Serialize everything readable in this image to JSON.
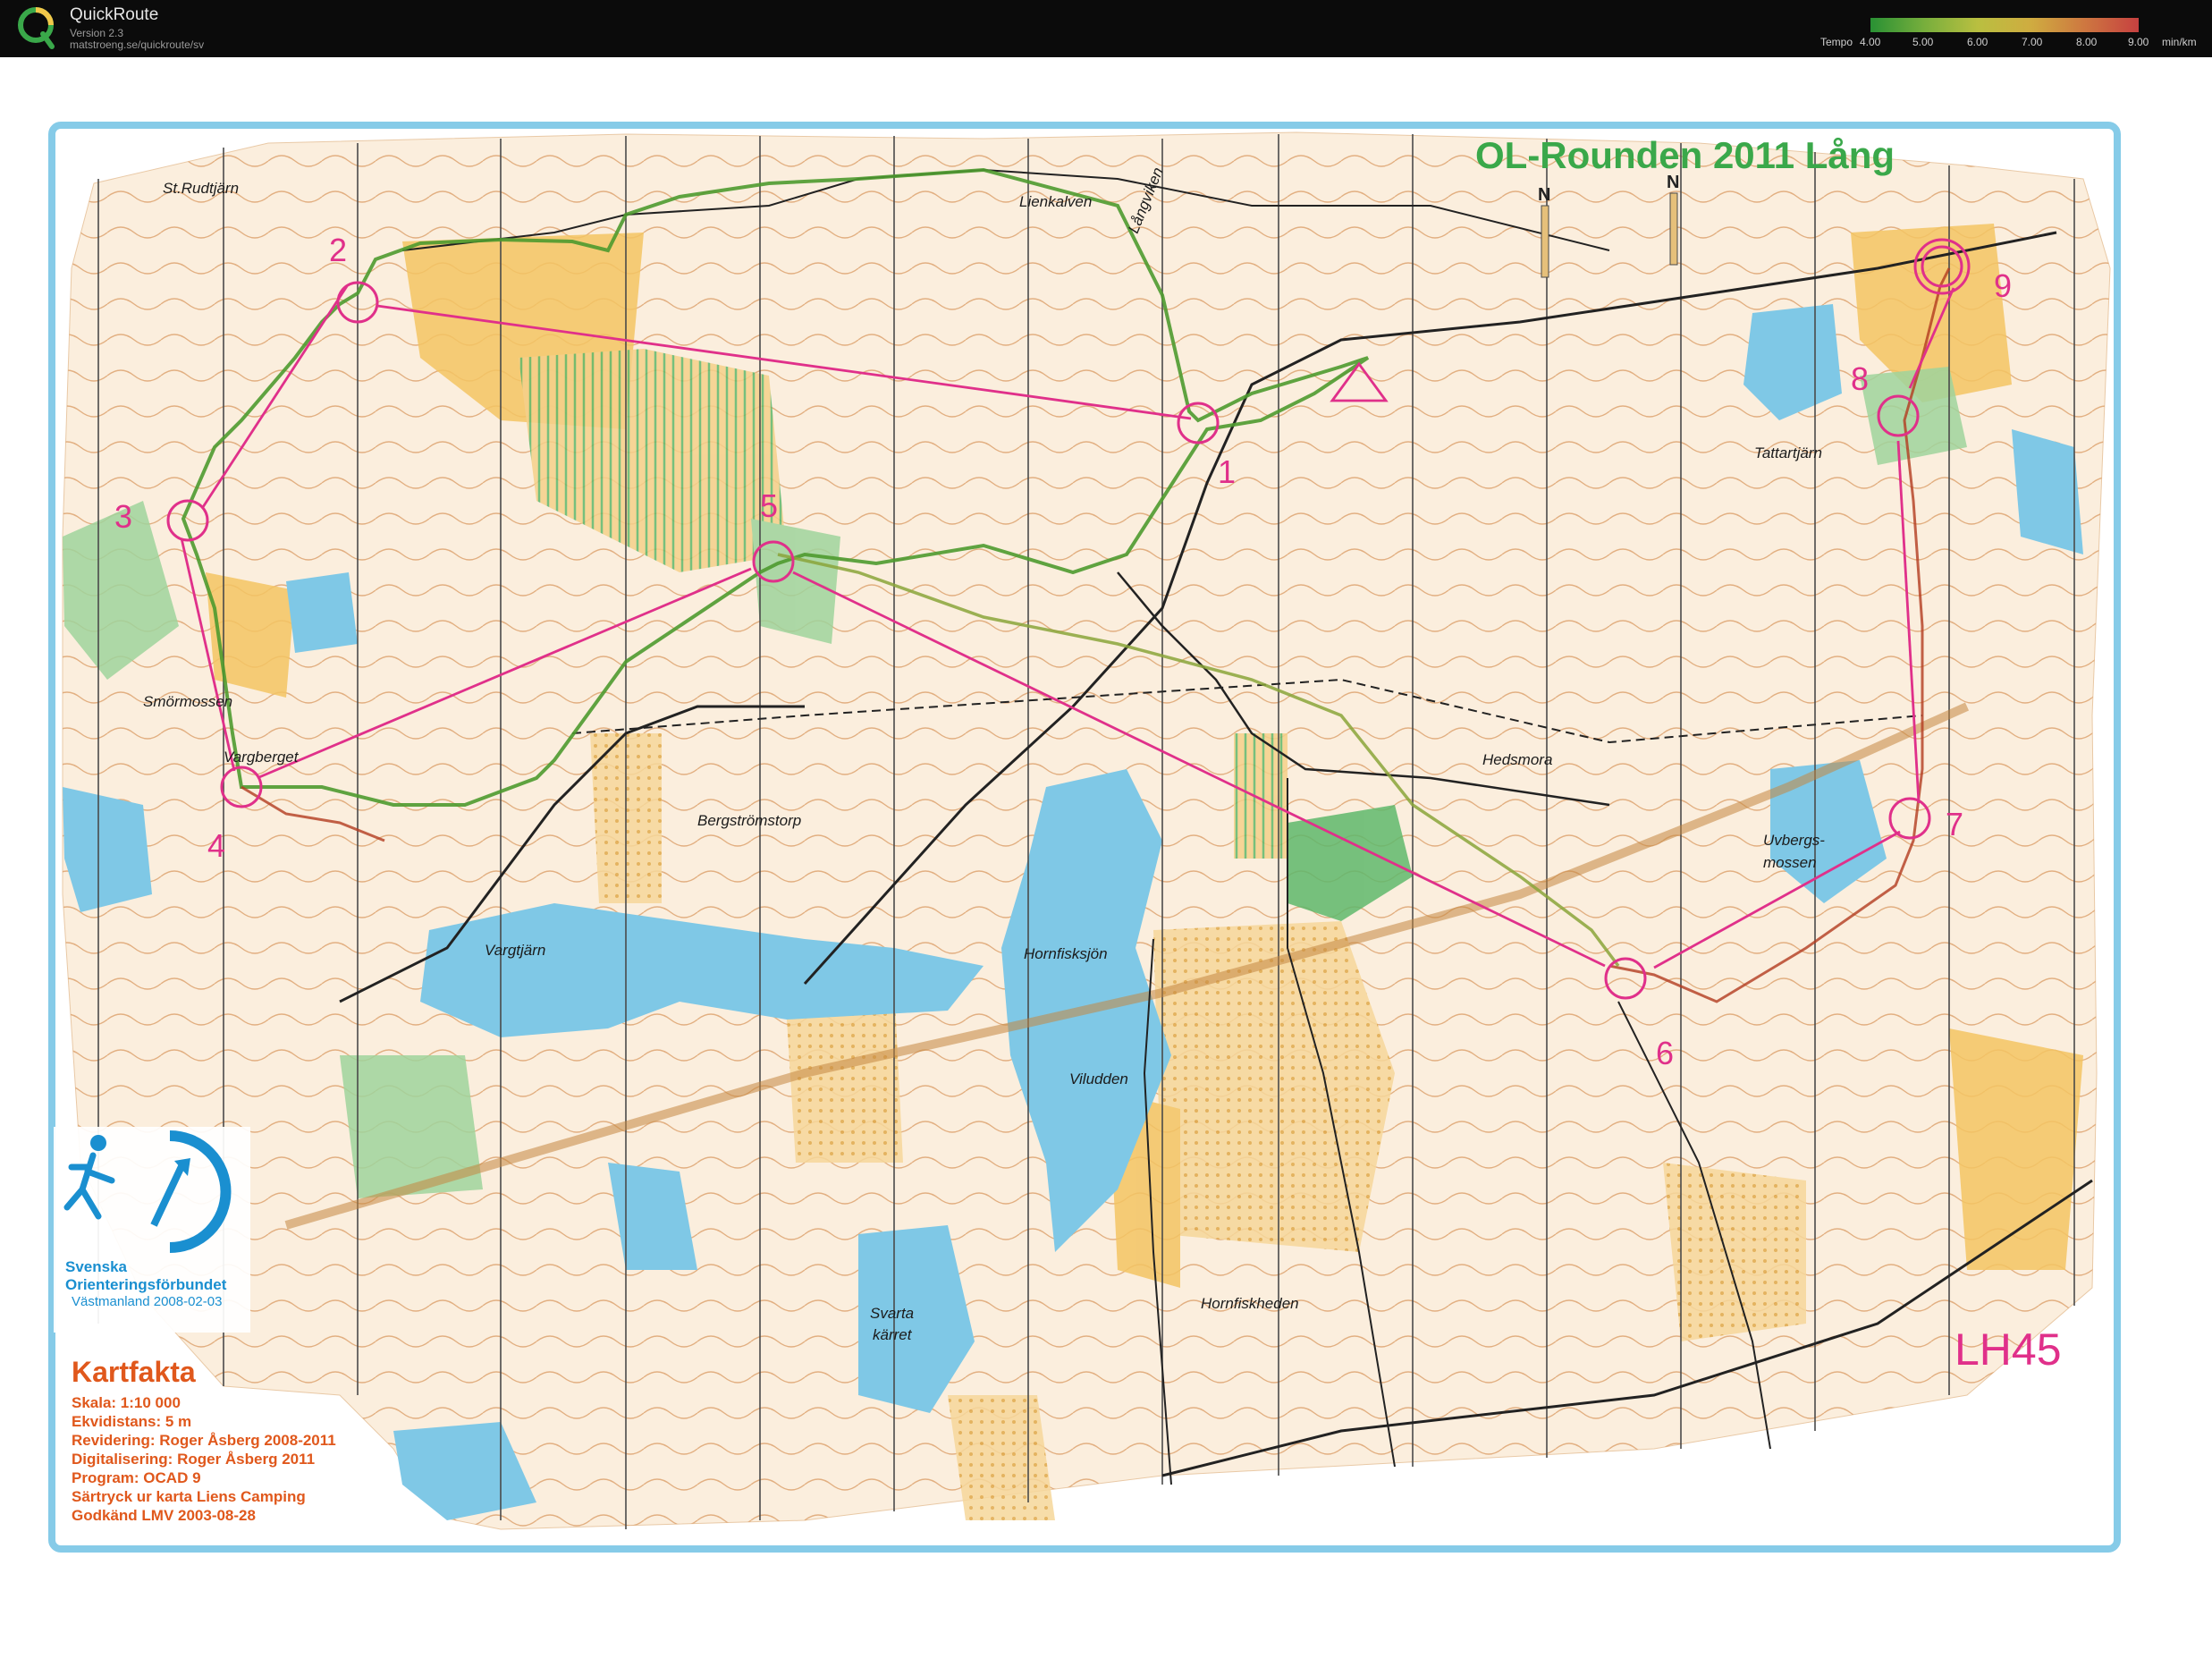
{
  "app": {
    "name": "QuickRoute",
    "version": "Version 2.3",
    "url": "matstroeng.se/quickroute/sv"
  },
  "tempo_legend": {
    "label": "Tempo",
    "ticks": [
      "4.00",
      "5.00",
      "6.00",
      "7.00",
      "8.00",
      "9.00"
    ],
    "unit": "min/km",
    "gradient_colors": [
      "#2ea83b",
      "#8acb45",
      "#d8df4a",
      "#f2c84a",
      "#f08a4a",
      "#e74a4a"
    ]
  },
  "map": {
    "title": "OL-Rounden 2011 Lång",
    "class": "LH45",
    "north_label": "N",
    "places": [
      "St.Rudtjärn",
      "Lienkalven",
      "Långviken",
      "Tattartjärn",
      "Smörmossen",
      "Vargberget",
      "Hedsmora",
      "Bergströmstorp",
      "Uvbergs-",
      "mossen",
      "Vargtjärn",
      "Hornfisksjön",
      "Viludden",
      "Hornfiskheden",
      "Svarta",
      "kärret"
    ],
    "controls": [
      "1",
      "2",
      "3",
      "4",
      "5",
      "6",
      "7",
      "8",
      "9"
    ],
    "federation": {
      "name_line1": "Svenska",
      "name_line2": "Orienteringsförbundet",
      "region": "Västmanland 2008-02-03"
    },
    "kartfakta": {
      "heading": "Kartfakta",
      "lines": [
        "Skala: 1:10 000",
        "Ekvidistans: 5 m",
        "Revidering: Roger Åsberg 2008-2011",
        "Digitalisering: Roger Åsberg 2011",
        "Program: OCAD 9",
        "Särtryck ur karta Liens Camping",
        "Godkänd LMV 2003-08-28"
      ]
    },
    "colors": {
      "course": "#e0308a",
      "title": "#3aa84a",
      "kartfakta": "#e0581c",
      "water": "#7fc8e6",
      "yellow": "#f3c463",
      "green": "#6cc07a",
      "contour": "#d4782e"
    }
  }
}
